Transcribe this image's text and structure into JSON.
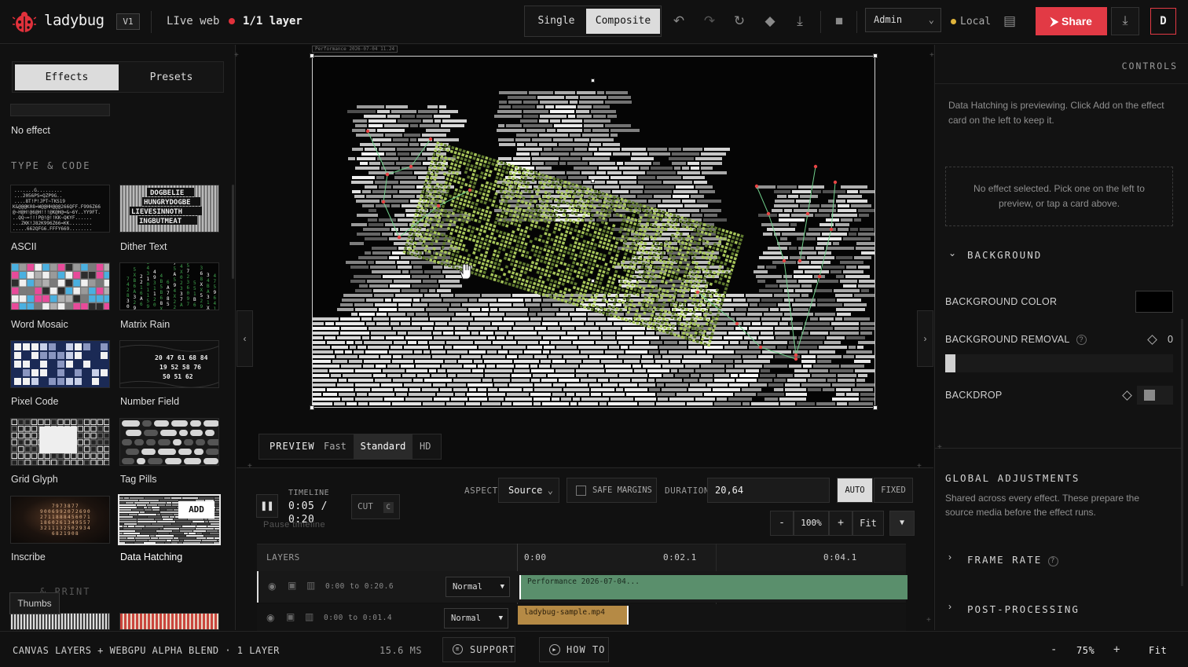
{
  "header": {
    "app_name": "ladybug",
    "version": "V1",
    "mode": "LIve web",
    "layer_count": "1/1 layer",
    "view_single": "Single",
    "view_composite": "Composite",
    "role_select": "Admin",
    "storage": "Local",
    "share_label": "Share",
    "avatar_initial": "D",
    "icons": [
      "undo-icon",
      "redo-icon",
      "refresh-icon",
      "eraser-icon",
      "download-icon",
      "camera-icon",
      "folder-icon"
    ]
  },
  "left_panel": {
    "tab_effects": "Effects",
    "tab_presets": "Presets",
    "no_effect": "No effect",
    "section_type_code": "TYPE & CODE",
    "section_print": "... & PRINT",
    "add_label": "ADD",
    "tooltip": "Thumbs",
    "effects": [
      {
        "label": "ASCII"
      },
      {
        "label": "Dither Text"
      },
      {
        "label": "Word Mosaic"
      },
      {
        "label": "Matrix Rain"
      },
      {
        "label": "Pixel Code"
      },
      {
        "label": "Number Field"
      },
      {
        "label": "Grid Glyph"
      },
      {
        "label": "Tag Pills"
      },
      {
        "label": "Inscribe"
      },
      {
        "label": "Data Hatching"
      }
    ],
    "thumb_text": {
      "dither": [
        "DOGBELIE",
        "HUNGRYDOGBE",
        "LIEVESINNOTH",
        "INGBUTMEAT"
      ],
      "number_field": [
        "20 47 61 68 84",
        "19 52 58 76",
        "50 51 62"
      ],
      "ascii": [
        ".......G.........",
        "...2056PS=QZP9G..",
        "....8T!P!JPT~TKS19",
        "K&@@@K08=W@@HH@@@266QFF.F996Z66",
        "@~H@H!@6@H!!!@K@H@=&~6Y..YY9FT.",
        "..QQ~=!!!P@!@!!KK~QKYF......",
        "...ZKK!J82K996Z66=KK........",
        ".....662QFG6.FFFY669........"
      ]
    }
  },
  "canvas": {
    "stage_tag": "Performance 2026-07-04 11.24",
    "preview_label": "PREVIEW",
    "quality_options": [
      "Fast",
      "Standard",
      "HD"
    ],
    "quality_selected": "Standard"
  },
  "timeline": {
    "label": "TIMELINE",
    "time_current": "0:05 /",
    "time_total": "0:20",
    "pause_tooltip": "Pause timeline",
    "cut_label": "CUT",
    "cut_key": "C",
    "aspect_label": "ASPECT",
    "aspect_value": "Source",
    "safe_margins_label": "SAFE MARGINS",
    "duration_label": "DURATION",
    "duration_value": "20,64",
    "mode_auto": "AUTO",
    "mode_fixed": "FIXED",
    "zoom_minus": "-",
    "zoom_value": "100%",
    "zoom_plus": "+",
    "zoom_fit": "Fit",
    "layers_label": "LAYERS",
    "ruler": [
      "0:00",
      "0:02.1",
      "0:04.1"
    ],
    "layers": [
      {
        "range": "0:00 to 0:20.6",
        "blend": "Normal",
        "clip": "Performance 2026-07-04...",
        "clip_color": "#5a8f6c"
      },
      {
        "range": "0:00 to 0:01.4",
        "blend": "Normal",
        "clip": "ladybug-sample.mp4",
        "clip_color": "#b58a45"
      }
    ]
  },
  "right_panel": {
    "title": "CONTROLS",
    "preview_note": "Data Hatching is previewing. Click Add on the effect card on the left to keep it.",
    "empty_note": "No effect selected. Pick one on the left to preview, or tap a card above.",
    "background_section": "BACKGROUND",
    "background_color_label": "BACKGROUND COLOR",
    "background_color": "#000000",
    "background_removal_label": "BACKGROUND REMOVAL",
    "background_removal_value": "0",
    "backdrop_label": "BACKDROP",
    "global_title": "GLOBAL ADJUSTMENTS",
    "global_desc": "Shared across every effect. These prepare the source media before the effect runs.",
    "frame_rate_label": "FRAME RATE",
    "post_processing_label": "POST-PROCESSING"
  },
  "status_bar": {
    "pipeline": "CANVAS LAYERS + WEBGPU ALPHA BLEND · 1 LAYER",
    "frame_time": "15.6 MS",
    "support_label": "SUPPORT",
    "howto_label": "HOW TO",
    "zoom_minus": "-",
    "zoom_value": "75%",
    "zoom_plus": "+",
    "zoom_fit": "Fit"
  },
  "colors": {
    "accent_red": "#e23a45",
    "clip_green": "#5a8f6c",
    "hatch_green": "#a7c65a"
  }
}
